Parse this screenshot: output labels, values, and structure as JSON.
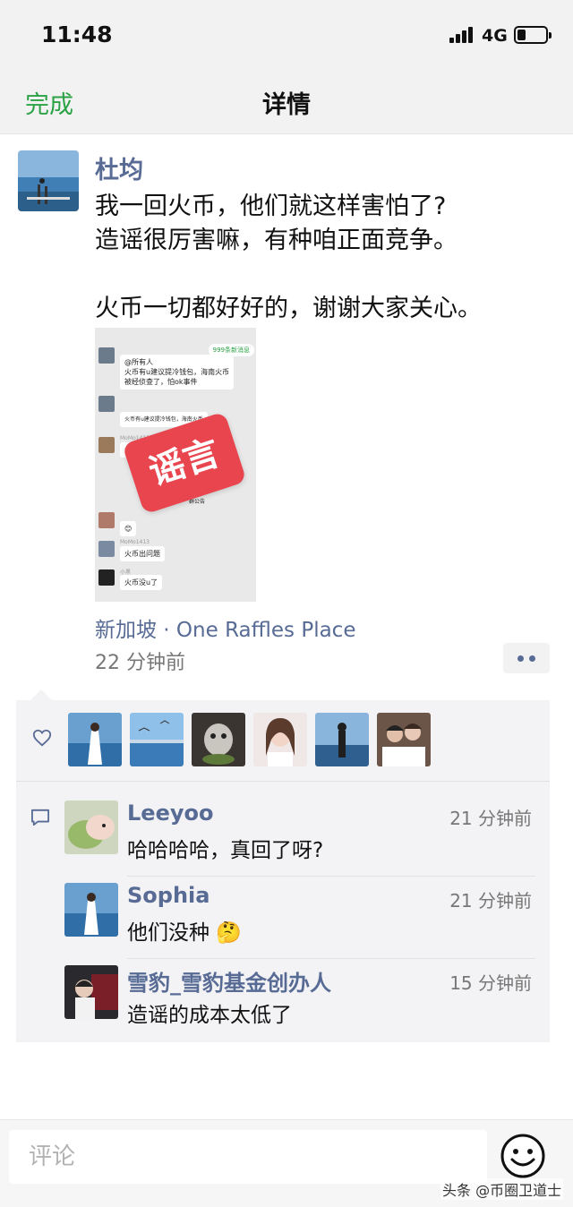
{
  "status_bar": {
    "time": "11:48",
    "network": "4G"
  },
  "nav": {
    "back_label": "完成",
    "title": "详情"
  },
  "post": {
    "author": "杜均",
    "lines": [
      "我一回火币，他们就这样害怕了?",
      "造谣很厉害嘛，有种咱正面竞争。",
      "火币一切都好好的，谢谢大家关心。"
    ],
    "image": {
      "stamp": "谣言",
      "new_messages": "999条新消息",
      "chat": [
        {
          "name": "",
          "text": "@所有人\n火币有u建议提冷钱包，海南火币\n被经侦查了，怕ok事件"
        },
        {
          "name": "",
          "text": "火币有u建议提冷钱包，海南火币"
        },
        {
          "name": "MoMo1413",
          "text": "😊"
        },
        {
          "name": "",
          "text": "群公告"
        },
        {
          "name": "MoMo1413",
          "text": "火币出问题"
        },
        {
          "name": "小黑",
          "text": "火币没u了"
        }
      ]
    },
    "location": "新加坡 · One Raffles Place",
    "time_ago": "22 分钟前"
  },
  "likes": {
    "count_avatars": 6
  },
  "comments": [
    {
      "name": "Leeyoo",
      "time": "21 分钟前",
      "text": "哈哈哈哈，真回了呀?"
    },
    {
      "name": "Sophia",
      "time": "21 分钟前",
      "text": "他们没种 🤔"
    },
    {
      "name": "雪豹_雪豹基金创办人",
      "time": "15 分钟前",
      "text": "造谣的成本太低了"
    }
  ],
  "comment_input": {
    "placeholder": "评论"
  },
  "watermark": "头条 @币圈卫道士",
  "colors": {
    "accent_green": "#2ba245",
    "link_blue": "#576b95",
    "rumor_red": "#e8454f"
  }
}
